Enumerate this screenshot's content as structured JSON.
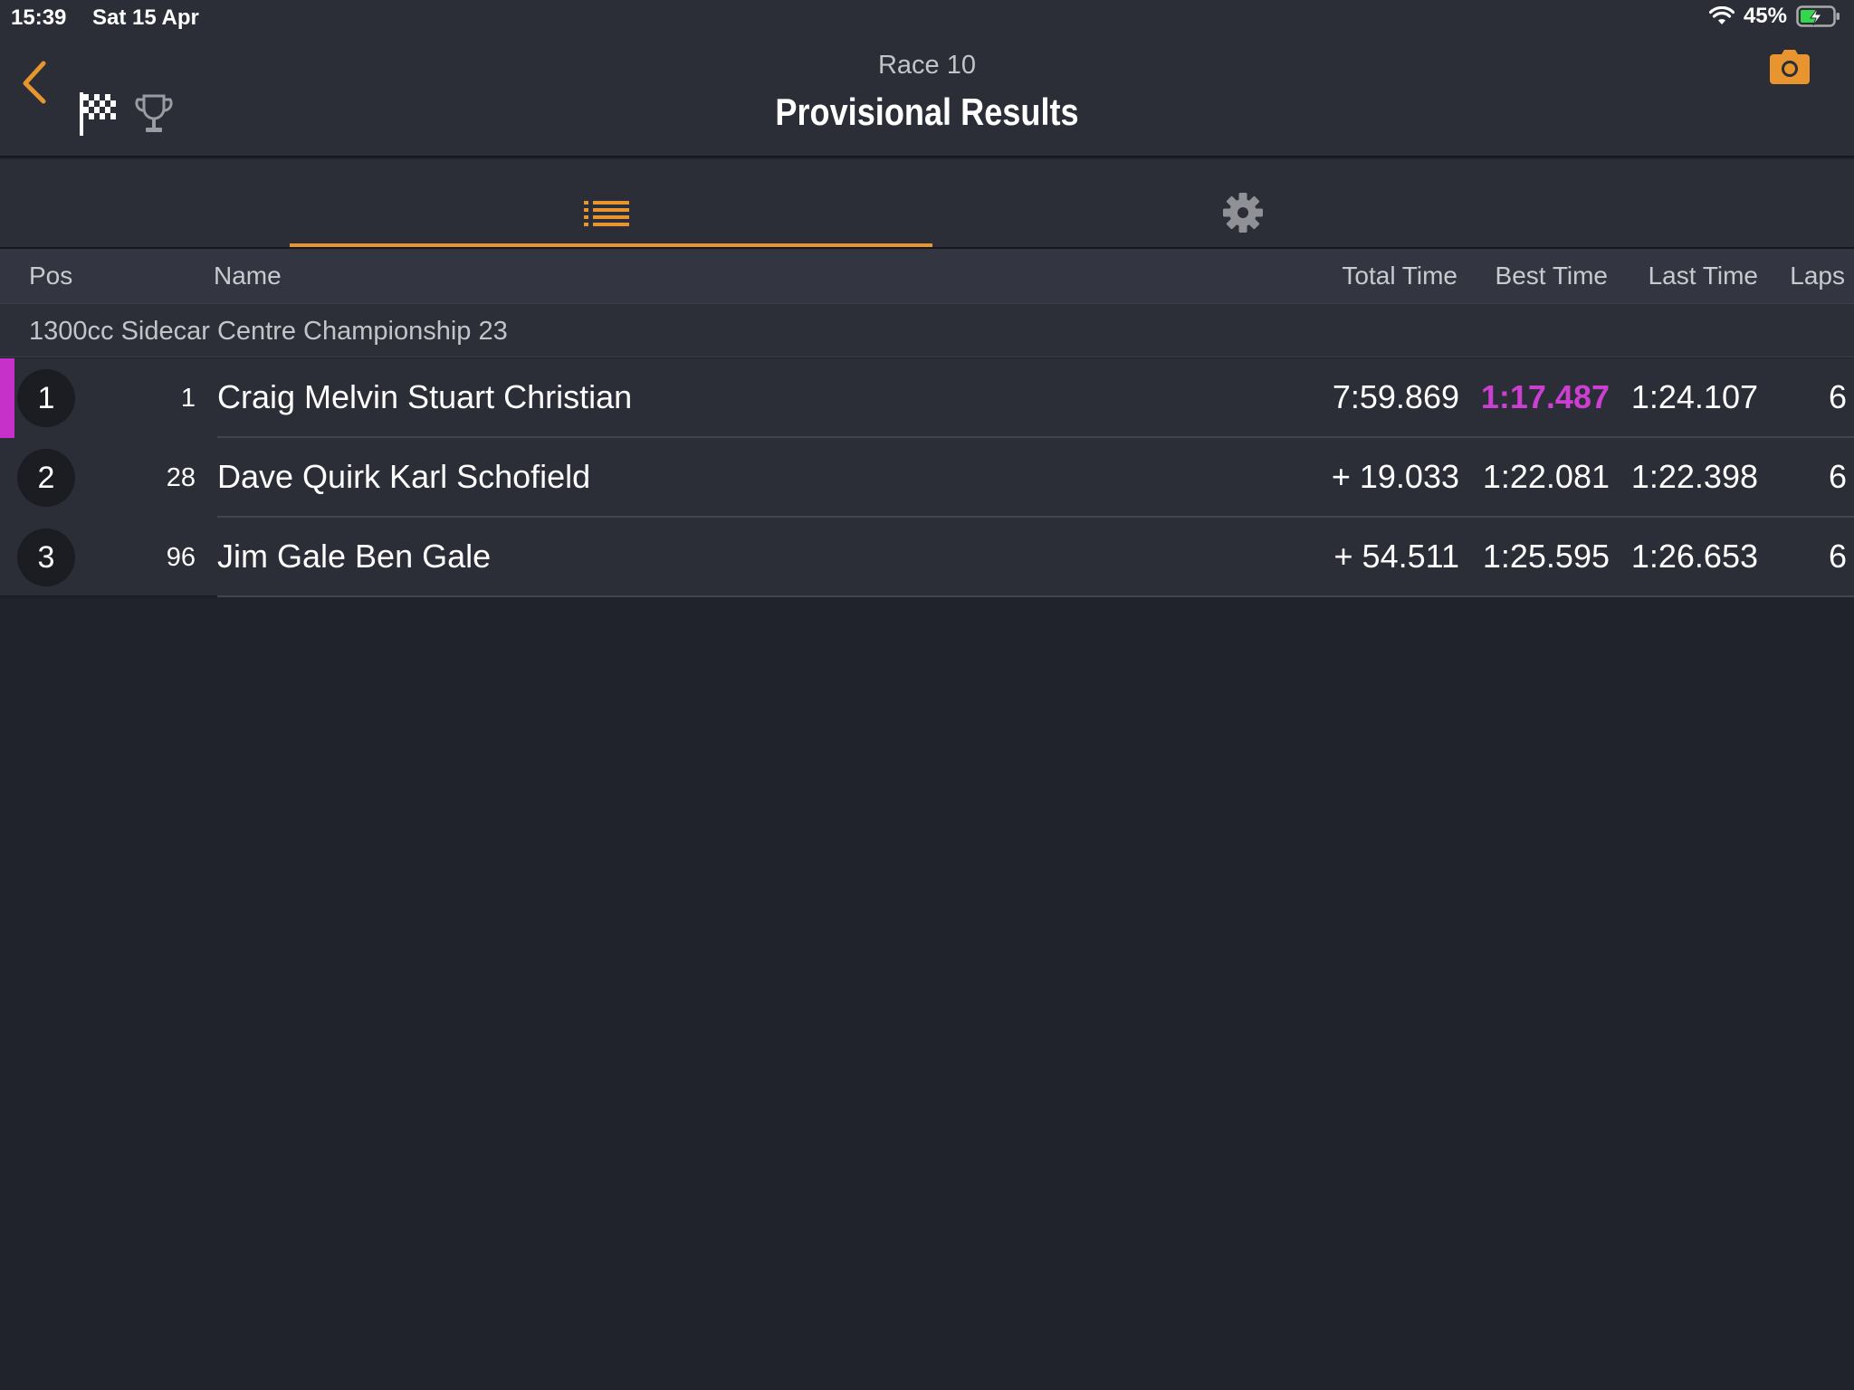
{
  "status_bar": {
    "time": "15:39",
    "date": "Sat 15 Apr",
    "battery": "45%"
  },
  "header": {
    "subtitle": "Race 10",
    "title": "Provisional Results"
  },
  "tabs": [
    {
      "icon": "list-icon",
      "active": true
    },
    {
      "icon": "gear-icon",
      "active": false
    }
  ],
  "columns": {
    "pos": "Pos",
    "name": "Name",
    "total": "Total Time",
    "best": "Best Time",
    "last": "Last Time",
    "laps": "Laps"
  },
  "group": {
    "label": "1300cc Sidecar Centre Championship 23"
  },
  "results": [
    {
      "pos": "1",
      "num": "1",
      "name": "Craig Melvin Stuart Christian",
      "total": "7:59.869",
      "best": "1:17.487",
      "last": "1:24.107",
      "laps": "6",
      "fastest": true
    },
    {
      "pos": "2",
      "num": "28",
      "name": "Dave Quirk Karl Schofield",
      "total": "+ 19.033",
      "best": "1:22.081",
      "last": "1:22.398",
      "laps": "6",
      "fastest": false
    },
    {
      "pos": "3",
      "num": "96",
      "name": "Jim Gale Ben Gale",
      "total": "+ 54.511",
      "best": "1:25.595",
      "last": "1:26.653",
      "laps": "6",
      "fastest": false
    }
  ],
  "colors": {
    "accent": "#e8952f",
    "fastest": "#cc3fd1",
    "background": "#20232c"
  }
}
